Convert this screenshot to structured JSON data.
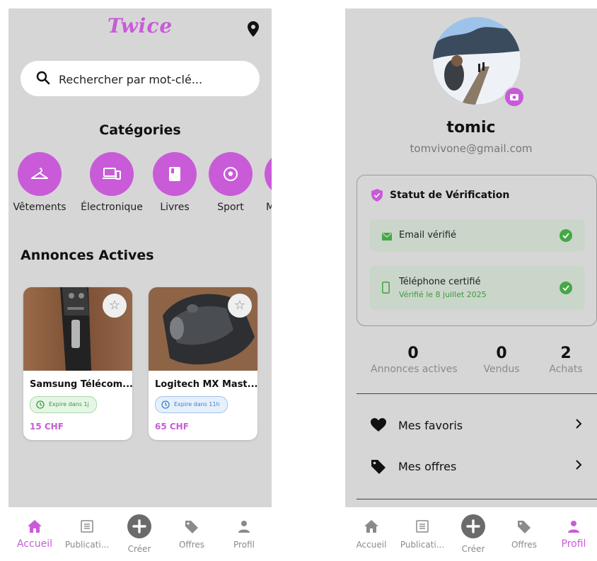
{
  "left_screen": {
    "logo": "Twice",
    "search": {
      "placeholder": "Rechercher par mot-clé..."
    },
    "categories_title": "Catégories",
    "categories": [
      {
        "label": "Vêtements",
        "icon": "hanger-icon"
      },
      {
        "label": "Électronique",
        "icon": "devices-icon"
      },
      {
        "label": "Livres",
        "icon": "book-icon"
      },
      {
        "label": "Sport",
        "icon": "soccer-ball-icon"
      },
      {
        "label": "M",
        "icon": "category-icon"
      }
    ],
    "annonces_title": "Annonces Actives",
    "listings": [
      {
        "title": "Samsung Télécom...",
        "expiry": "Expire dans 1j",
        "expiry_color": "green",
        "price": "15 CHF"
      },
      {
        "title": "Logitech MX Mast...",
        "expiry": "Expire dans 11h",
        "expiry_color": "blue",
        "price": "65 CHF"
      }
    ],
    "nav": [
      {
        "label": "Accueil",
        "icon": "home-icon",
        "active": true
      },
      {
        "label": "Publicati...",
        "icon": "list-icon",
        "active": false
      },
      {
        "label": "Créer",
        "icon": "plus-circle-icon",
        "active": false
      },
      {
        "label": "Offres",
        "icon": "tag-icon",
        "active": false
      },
      {
        "label": "Profil",
        "icon": "person-icon",
        "active": false
      }
    ]
  },
  "right_screen": {
    "username": "tomic",
    "email": "tomvivone@gmail.com",
    "verification": {
      "title": "Statut de Vérification",
      "email_label": "Email vérifié",
      "phone_label": "Téléphone certifié",
      "phone_sub": "Vérifié le 8 juillet 2025"
    },
    "stats": [
      {
        "value": "0",
        "label": "Annonces actives"
      },
      {
        "value": "0",
        "label": "Vendus"
      },
      {
        "value": "2",
        "label": "Achats"
      }
    ],
    "menu": [
      {
        "label": "Mes favoris",
        "icon": "heart-icon"
      },
      {
        "label": "Mes offres",
        "icon": "tag-icon"
      }
    ],
    "nav": [
      {
        "label": "Accueil",
        "icon": "home-icon",
        "active": false
      },
      {
        "label": "Publicati...",
        "icon": "list-icon",
        "active": false
      },
      {
        "label": "Créer",
        "icon": "plus-circle-icon",
        "active": false
      },
      {
        "label": "Offres",
        "icon": "tag-icon",
        "active": false
      },
      {
        "label": "Profil",
        "icon": "person-icon",
        "active": true
      }
    ]
  },
  "colors": {
    "accent": "#c95bd9",
    "screen_bg": "#d6d6d6",
    "verified_green": "#45a845",
    "expiry_blue": "#3a7fd0"
  }
}
